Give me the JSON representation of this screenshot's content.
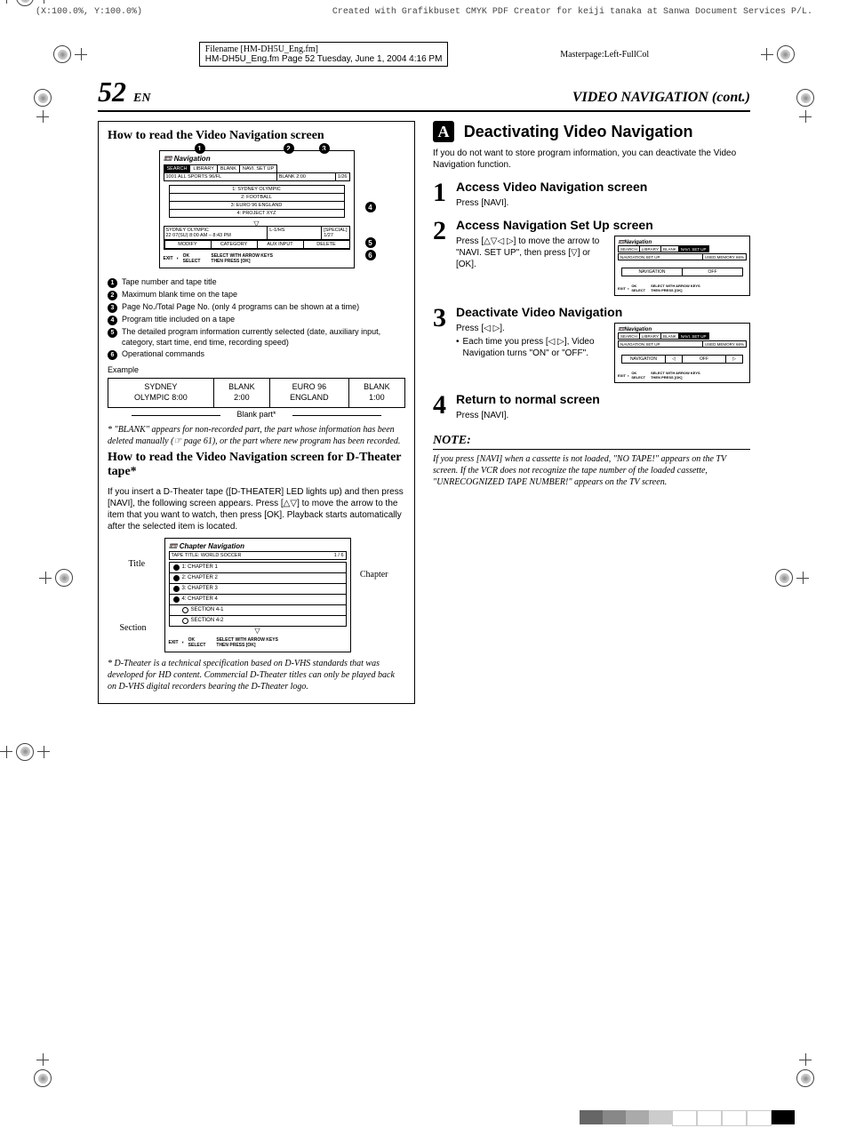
{
  "meta": {
    "top_left": "(X:100.0%, Y:100.0%)",
    "top_right": "Created with Grafikbuset CMYK PDF Creator for keiji tanaka at Sanwa Document Services P/L.",
    "filename": "Filename [HM-DH5U_Eng.fm]",
    "header_line": "HM-DH5U_Eng.fm  Page 52  Tuesday, June 1, 2004  4:16 PM",
    "masterpage": "Masterpage:Left-FullCol"
  },
  "page": {
    "number": "52",
    "lang": "EN",
    "section": "VIDEO NAVIGATION (cont.)"
  },
  "left": {
    "box1_title": "How to read the Video Navigation screen",
    "osd1": {
      "logo": "Navigation",
      "tabs": [
        "SEARCH",
        "LIBRARY",
        "BLANK",
        "NAVI. SET UP"
      ],
      "row": [
        "1001 ALL SPORTS 96/FL",
        "BLANK 2:00",
        "1/26"
      ],
      "list": [
        "1: SYDNEY OLYMPIC",
        "2: FOOTBALL",
        "3: EURO 96 ENGLAND",
        "4: PROJECT XYZ"
      ],
      "detail_left": "SYDNEY OLYMPIC\n22 07(SU) 8:00 AM – 8:43 PM",
      "detail_mid": "L-1/HS",
      "detail_right": "[SPECIAL]\n1/27",
      "btns": [
        "MODIFY",
        "CATEGORY",
        "AUX INPUT",
        "DELETE"
      ],
      "foot_exit": "EXIT",
      "foot_ok": "OK",
      "foot_select": "SELECT",
      "foot_msg": "SELECT WITH ARROW KEYS\nTHEN PRESS [OK]"
    },
    "legend": [
      "Tape number and tape title",
      "Maximum blank time on the tape",
      "Page No./Total Page No. (only 4 programs can be shown at a time)",
      "Program title included on a tape",
      "The detailed program information currently selected (date, auxiliary input, category, start time, end time, recording speed)",
      "Operational commands"
    ],
    "example_label": "Example",
    "example": [
      {
        "l1": "SYDNEY",
        "l2": "OLYMPIC 8:00"
      },
      {
        "l1": "BLANK",
        "l2": "2:00"
      },
      {
        "l1": "EURO 96",
        "l2": "ENGLAND"
      },
      {
        "l1": "BLANK",
        "l2": "1:00"
      }
    ],
    "blank_part": "Blank part*",
    "footnote1": "* \"BLANK\" appears for non-recorded part, the part whose information has been deleted manually (☞ page 61), or the part where new program has been recorded.",
    "box2_title": "How to read the Video Navigation screen for D-Theater tape*",
    "box2_para": "If you insert a D-Theater tape ([D-THEATER] LED lights up) and then press [NAVI], the following screen appears. Press [△▽] to move the arrow to the item that you want to watch, then press [OK]. Playback starts automatically after the selected item is located.",
    "osd2": {
      "logo": "Chapter Navigation",
      "tape_title": "TAPE TITLE: WORLD SOCCER",
      "page": "1 / 6",
      "items": [
        "1: CHAPTER 1",
        "2: CHAPTER 2",
        "3: CHAPTER 3",
        "4: CHAPTER 4",
        "SECTION 4-1",
        "SECTION 4-2"
      ],
      "title_label": "Title",
      "chapter_label": "Chapter",
      "section_label": "Section"
    },
    "footnote2": "* D-Theater is a technical specification based on D-VHS standards that was developed for HD content. Commercial D-Theater titles can only be played back on D-VHS digital recorders bearing the D-Theater logo."
  },
  "right": {
    "letter": "A",
    "title": "Deactivating Video Navigation",
    "intro": "If you do not want to store program information, you can deactivate the Video Navigation function.",
    "steps": [
      {
        "n": "1",
        "title": "Access Video Navigation screen",
        "text": "Press [NAVI]."
      },
      {
        "n": "2",
        "title": "Access Navigation Set Up screen",
        "text": "Press [△▽◁ ▷] to move the arrow to \"NAVI. SET UP\", then press [▽] or [OK]."
      },
      {
        "n": "3",
        "title": "Deactivate Video Navigation",
        "text": "Press [◁ ▷].",
        "bullet": "Each time you press [◁ ▷], Video Navigation turns \"ON\" or \"OFF\"."
      },
      {
        "n": "4",
        "title": "Return to normal screen",
        "text": "Press [NAVI]."
      }
    ],
    "mini_osd": {
      "tabs": [
        "SEARCH",
        "LIBRARY",
        "BLANK",
        "NAVI. SET UP"
      ],
      "bar": [
        "NAVIGATION SET UP",
        "USED MEMORY  66%"
      ],
      "field2": [
        "NAVIGATION",
        "OFF"
      ],
      "field3": [
        "NAVIGATION",
        "◁",
        "OFF",
        "▷"
      ],
      "foot": "SELECT WITH ARROW KEYS\nTHEN PRESS [OK]"
    },
    "note_h": "NOTE:",
    "note": "If you press [NAVI] when a cassette is not loaded, \"NO TAPE!\" appears on the TV screen. If the VCR does not recognize the tape number of the loaded cassette, \"UNRECOGNIZED TAPE NUMBER!\" appears on the TV screen."
  }
}
